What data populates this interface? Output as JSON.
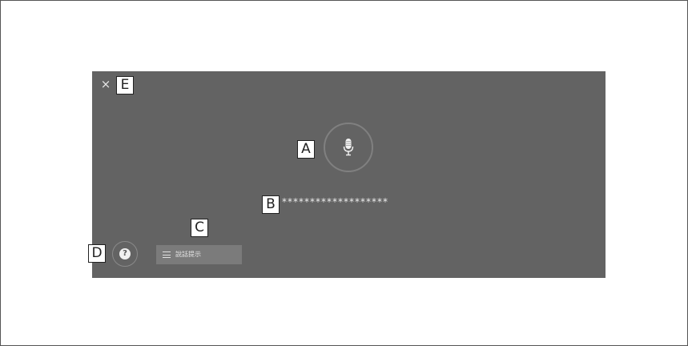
{
  "dialog": {
    "close_glyph": "×",
    "recognized_text": "*******************",
    "help_glyph": "?",
    "hint_button_label": "說話提示"
  },
  "callouts": {
    "a": "A",
    "b": "B",
    "c": "C",
    "d": "D",
    "e": "E"
  },
  "icons": {
    "mic": "microphone-icon",
    "help": "question-mark-icon",
    "hint": "list-icon",
    "close": "close-icon"
  },
  "colors": {
    "screen_background": "#636363",
    "hint_button_background": "#7b7b7b",
    "text": "#eeeeee"
  }
}
